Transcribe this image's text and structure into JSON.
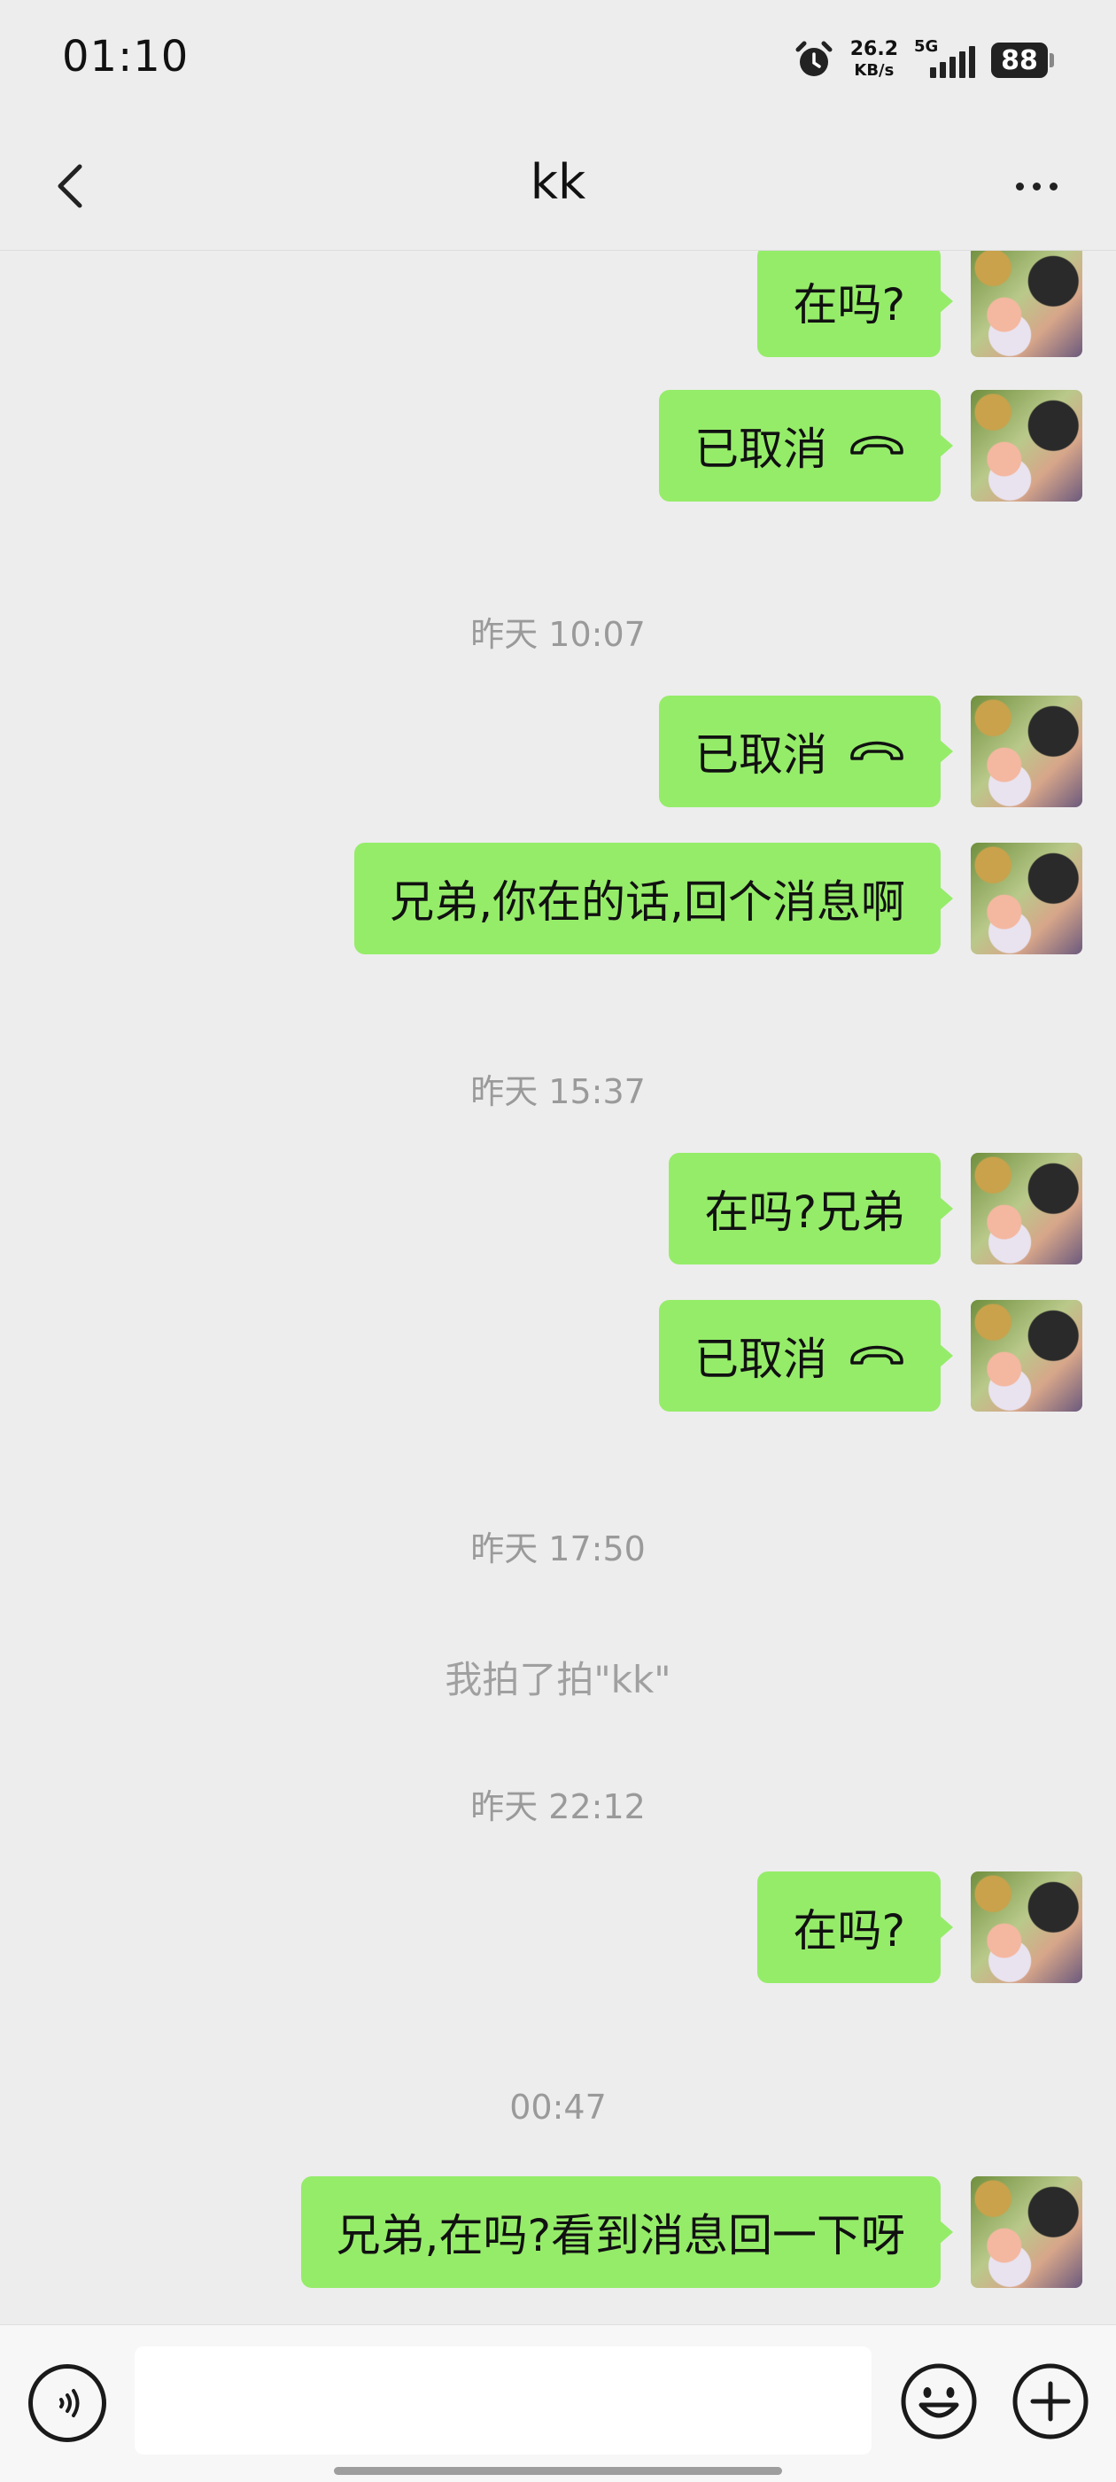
{
  "status_bar": {
    "time": "01:10",
    "net_speed_value": "26.2",
    "net_speed_unit": "KB/s",
    "network_type": "5G",
    "battery": "88",
    "icons": [
      "alarm-icon",
      "signal-icon",
      "battery-icon"
    ]
  },
  "header": {
    "title": "kk",
    "back_icon": "chevron-left-icon",
    "more_icon": "more-horizontal-icon"
  },
  "messages": [
    {
      "type": "sent",
      "text": "在吗?",
      "call": false
    },
    {
      "type": "sent",
      "text": "已取消",
      "call": true
    },
    {
      "type": "time",
      "text": "昨天 10:07"
    },
    {
      "type": "sent",
      "text": "已取消",
      "call": true
    },
    {
      "type": "sent",
      "text": "兄弟,你在的话,回个消息啊",
      "call": false
    },
    {
      "type": "time",
      "text": "昨天 15:37"
    },
    {
      "type": "sent",
      "text": "在吗?兄弟",
      "call": false
    },
    {
      "type": "sent",
      "text": "已取消",
      "call": true
    },
    {
      "type": "time",
      "text": "昨天 17:50"
    },
    {
      "type": "notice",
      "text": "我拍了拍\"kk\""
    },
    {
      "type": "time",
      "text": "昨天 22:12"
    },
    {
      "type": "sent",
      "text": "在吗?",
      "call": false
    },
    {
      "type": "time",
      "text": "00:47"
    },
    {
      "type": "sent",
      "text": "兄弟,在吗?看到消息回一下呀",
      "call": false
    }
  ],
  "input_bar": {
    "value": "",
    "placeholder": "",
    "icons": [
      "voice-icon",
      "emoji-icon",
      "plus-icon"
    ]
  },
  "colors": {
    "background": "#ededed",
    "sent_bubble": "#95ec69",
    "timestamp_text": "#9a9a9a"
  }
}
